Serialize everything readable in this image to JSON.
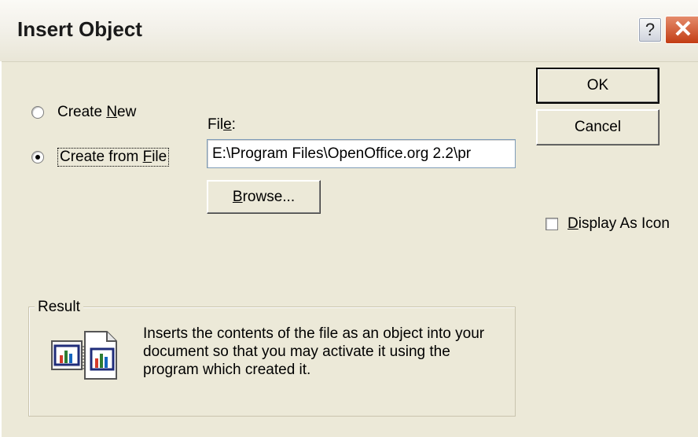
{
  "dialog": {
    "title": "Insert Object",
    "help_glyph": "?",
    "close_glyph": "✕"
  },
  "options": {
    "create_new": {
      "label_pre": "Create ",
      "label_key": "N",
      "label_post": "ew",
      "checked": false
    },
    "create_from_file": {
      "label_pre": "Create from ",
      "label_key": "F",
      "label_post": "ile",
      "checked": true
    }
  },
  "file": {
    "label_pre": "Fil",
    "label_key": "e",
    "label_post": ":",
    "value": "E:\\Program Files\\OpenOffice.org 2.2\\pr"
  },
  "buttons": {
    "browse_key": "B",
    "browse_rest": "rowse...",
    "ok": "OK",
    "cancel": "Cancel"
  },
  "display_as_icon": {
    "label_key": "D",
    "label_rest": "isplay As Icon",
    "checked": false
  },
  "result": {
    "title": "Result",
    "text": "Inserts the contents of the file as an object into your document so that you may activate it using the program which created it.",
    "icon": "insert-object-file-icon"
  }
}
